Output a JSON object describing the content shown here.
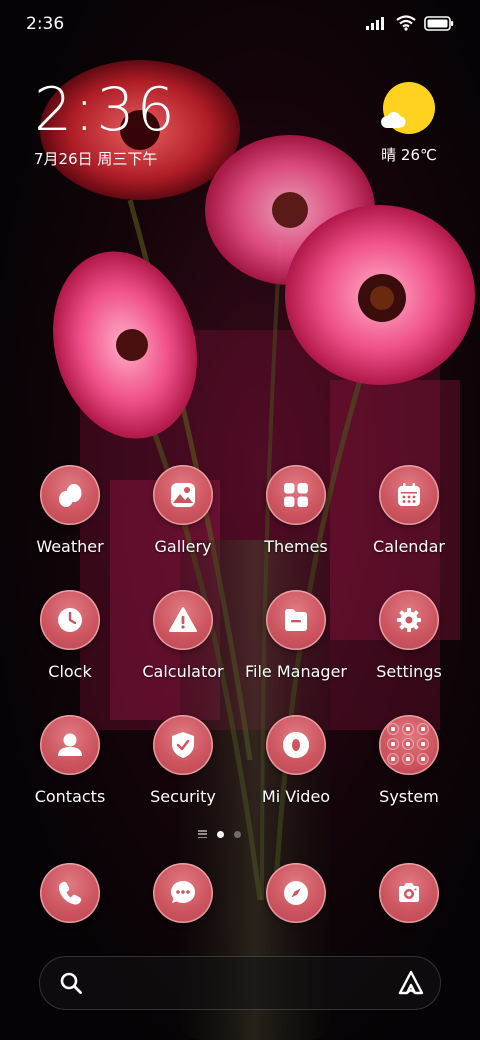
{
  "status_bar": {
    "time": "2:36",
    "icons": [
      "signal-icon",
      "wifi-icon",
      "battery-icon"
    ]
  },
  "clock_widget": {
    "time": "2:36",
    "date": "7月26日 周三下午"
  },
  "weather_widget": {
    "icon": "sunny-cloud-icon",
    "text": "晴 26℃"
  },
  "apps": [
    {
      "label": "Weather",
      "icon": "weather-icon"
    },
    {
      "label": "Gallery",
      "icon": "gallery-icon"
    },
    {
      "label": "Themes",
      "icon": "themes-icon"
    },
    {
      "label": "Calendar",
      "icon": "calendar-icon"
    },
    {
      "label": "Clock",
      "icon": "clock-icon"
    },
    {
      "label": "Calculator",
      "icon": "calculator-icon"
    },
    {
      "label": "File Manager",
      "icon": "file-manager-icon"
    },
    {
      "label": "Settings",
      "icon": "settings-icon"
    },
    {
      "label": "Contacts",
      "icon": "contacts-icon"
    },
    {
      "label": "Security",
      "icon": "security-icon"
    },
    {
      "label": "Mi Video",
      "icon": "mi-video-icon"
    },
    {
      "label": "System",
      "icon": "folder-icon"
    }
  ],
  "page_indicator": {
    "pages": 2,
    "active_page": 1
  },
  "dock": [
    {
      "icon": "phone-icon"
    },
    {
      "icon": "messages-icon"
    },
    {
      "icon": "browser-icon"
    },
    {
      "icon": "camera-icon"
    }
  ],
  "search_bar": {
    "left_icon": "search-icon",
    "right_icon": "assistant-icon"
  },
  "colors": {
    "icon_fill": "#cc5560",
    "icon_border": "#f0b8bc",
    "weather_sun": "#ffd21f"
  }
}
